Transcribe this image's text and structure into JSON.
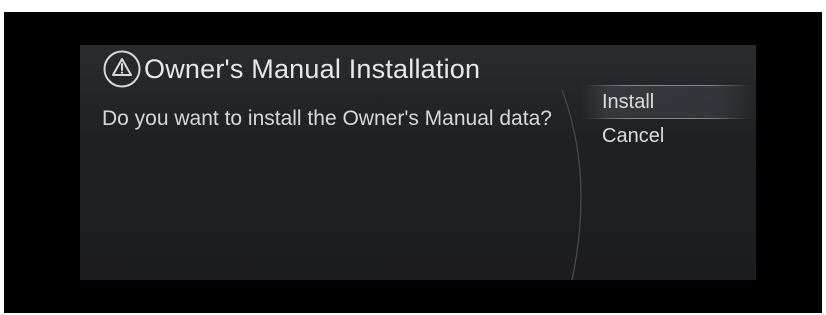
{
  "dialog": {
    "icon": "warning-triangle-icon",
    "title": "Owner's Manual Installation",
    "message": "Do you want to install the Owner's Manual data?"
  },
  "menu": {
    "items": [
      {
        "label": "Install",
        "selected": true
      },
      {
        "label": "Cancel",
        "selected": false
      }
    ]
  }
}
